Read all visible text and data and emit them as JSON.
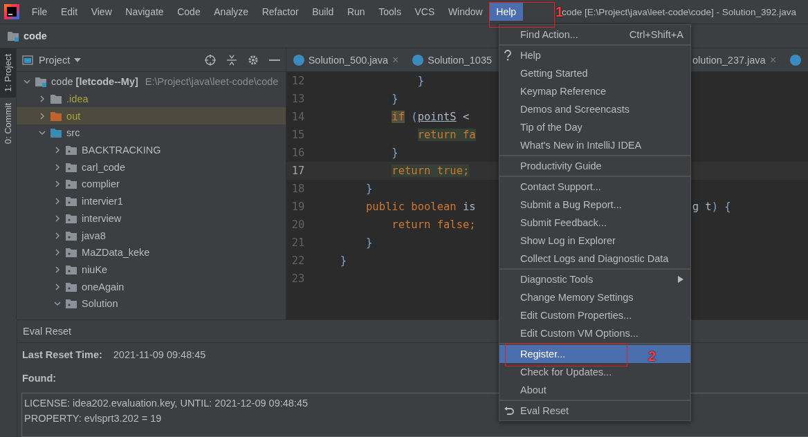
{
  "menubar": {
    "items": [
      {
        "label": "File",
        "selected": false
      },
      {
        "label": "Edit",
        "selected": false
      },
      {
        "label": "View",
        "selected": false
      },
      {
        "label": "Navigate",
        "selected": false
      },
      {
        "label": "Code",
        "selected": false
      },
      {
        "label": "Analyze",
        "selected": false
      },
      {
        "label": "Refactor",
        "selected": false
      },
      {
        "label": "Build",
        "selected": false
      },
      {
        "label": "Run",
        "selected": false
      },
      {
        "label": "Tools",
        "selected": false
      },
      {
        "label": "VCS",
        "selected": false
      },
      {
        "label": "Window",
        "selected": false
      },
      {
        "label": "Help",
        "selected": true
      }
    ],
    "title": "code [E:\\Project\\java\\leet-code\\code] - Solution_392.java"
  },
  "navbar": {
    "crumb": "code"
  },
  "left_stripe": [
    {
      "label": "1: Project",
      "selected": true
    },
    {
      "label": "0: Commit",
      "selected": false
    }
  ],
  "project_panel": {
    "title": "Project",
    "tree": [
      {
        "label": "code **[letcode--My]**",
        "path": "E:\\Project\\java\\leet-code\\code",
        "kind": "module",
        "expanded": true,
        "selected": false,
        "children": [
          {
            "label": ".idea",
            "kind": "excluded",
            "expanded": false,
            "selected": false
          },
          {
            "label": "out",
            "kind": "output",
            "expanded": false,
            "selected": true
          },
          {
            "label": "src",
            "kind": "source",
            "expanded": true,
            "selected": false,
            "children": [
              {
                "label": "BACKTRACKING",
                "kind": "package",
                "expanded": false,
                "selected": false
              },
              {
                "label": "carl_code",
                "kind": "package",
                "expanded": false,
                "selected": false
              },
              {
                "label": "complier",
                "kind": "package",
                "expanded": false,
                "selected": false
              },
              {
                "label": "intervier1",
                "kind": "package",
                "expanded": false,
                "selected": false
              },
              {
                "label": "interview",
                "kind": "package",
                "expanded": false,
                "selected": false
              },
              {
                "label": "java8",
                "kind": "package",
                "expanded": false,
                "selected": false
              },
              {
                "label": "MaZData_keke",
                "kind": "package",
                "expanded": false,
                "selected": false
              },
              {
                "label": "niuKe",
                "kind": "package",
                "expanded": false,
                "selected": false
              },
              {
                "label": "oneAgain",
                "kind": "package",
                "expanded": false,
                "selected": false
              },
              {
                "label": "Solution",
                "kind": "package",
                "expanded": true,
                "selected": false
              }
            ]
          }
        ]
      }
    ]
  },
  "editor": {
    "tabs_left": [
      {
        "label": "Solution_500.java",
        "close": "×",
        "selected": false
      },
      {
        "label": "Solution_1035",
        "selected": false
      }
    ],
    "tabs_right": [
      {
        "label": "olution_237.java",
        "close": "×",
        "selected": false
      }
    ],
    "lines": [
      {
        "number": "12",
        "current": false,
        "segments": [
          {
            "text": "            }",
            "kind": "brace"
          }
        ]
      },
      {
        "number": "13",
        "current": false,
        "segments": [
          {
            "text": "        }",
            "kind": "brace"
          }
        ]
      },
      {
        "number": "14",
        "current": false,
        "segments": [
          {
            "text": "        if",
            "kind": "usage"
          },
          {
            "text": " (",
            "kind": "brace"
          },
          {
            "text": "pointS",
            "kind": "field"
          },
          {
            "text": " < ",
            "kind": "plain"
          }
        ]
      },
      {
        "number": "15",
        "current": false,
        "segments": [
          {
            "text": "            return fa",
            "kind": "exit"
          }
        ]
      },
      {
        "number": "16",
        "current": false,
        "segments": [
          {
            "text": "        }",
            "kind": "brace"
          }
        ]
      },
      {
        "number": "17",
        "current": true,
        "segments": [
          {
            "text": "        return true;",
            "kind": "exit"
          }
        ]
      },
      {
        "number": "18",
        "current": false,
        "segments": [
          {
            "text": "    }",
            "kind": "brace"
          }
        ]
      },
      {
        "number": "19",
        "current": false,
        "segments": [
          {
            "text": "    public boolean ",
            "kind": "keyword"
          },
          {
            "text": "is",
            "kind": "plain"
          }
        ],
        "tail": [
          {
            "text": "g t",
            "kind": "plain"
          },
          {
            "text": ") {",
            "kind": "brace"
          }
        ]
      },
      {
        "number": "20",
        "current": false,
        "segments": [
          {
            "text": "        return false;",
            "kind": "keyword"
          }
        ]
      },
      {
        "number": "21",
        "current": false,
        "segments": [
          {
            "text": "    }",
            "kind": "brace"
          }
        ]
      },
      {
        "number": "22",
        "current": false,
        "segments": [
          {
            "text": "}",
            "kind": "brace"
          }
        ]
      },
      {
        "number": "23",
        "current": false
      }
    ]
  },
  "help_menu": {
    "groups": [
      [
        {
          "label": "Find Action...",
          "shortcut": "Ctrl+Shift+A",
          "selected": false
        }
      ],
      [
        {
          "label": "Help",
          "kind": "question",
          "selected": false
        },
        {
          "label": "Getting Started",
          "selected": false
        },
        {
          "label": "Keymap Reference",
          "selected": false
        },
        {
          "label": "Demos and Screencasts",
          "selected": false
        },
        {
          "label": "Tip of the Day",
          "selected": false
        },
        {
          "label": "What's New in IntelliJ IDEA",
          "selected": false
        }
      ],
      [
        {
          "label": "Productivity Guide",
          "selected": false
        }
      ],
      [
        {
          "label": "Contact Support...",
          "selected": false
        },
        {
          "label": "Submit a Bug Report...",
          "selected": false
        },
        {
          "label": "Submit Feedback...",
          "selected": false
        },
        {
          "label": "Show Log in Explorer",
          "selected": false
        },
        {
          "label": "Collect Logs and Diagnostic Data",
          "selected": false
        }
      ],
      [
        {
          "label": "Diagnostic Tools",
          "submenu": true,
          "selected": false
        },
        {
          "label": "Change Memory Settings",
          "selected": false
        },
        {
          "label": "Edit Custom Properties...",
          "selected": false
        },
        {
          "label": "Edit Custom VM Options...",
          "selected": false
        }
      ],
      [
        {
          "label": "Register...",
          "selected": true
        },
        {
          "label": "Check for Updates...",
          "selected": false
        },
        {
          "label": "About",
          "selected": false
        }
      ],
      [
        {
          "label": "Eval Reset",
          "kind": "undo",
          "selected": false
        }
      ]
    ]
  },
  "eval_reset": {
    "title": "Eval Reset",
    "fields": [
      {
        "label": "Last Reset Time:",
        "value": "2021-11-09 09:48:45"
      },
      {
        "label": "Found:"
      }
    ],
    "found_lines": [
      "LICENSE: idea202.evaluation.key, UNTIL: 2021-12-09 09:48:45",
      "PROPERTY: evlsprt3.202 = 19"
    ]
  },
  "annotations": [
    {
      "label": "1"
    },
    {
      "label": "2"
    }
  ]
}
